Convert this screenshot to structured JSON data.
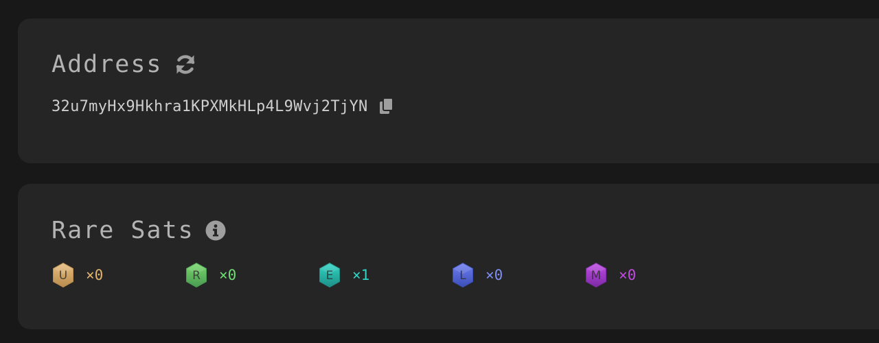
{
  "address": {
    "title": "Address",
    "value": "32u7myHx9Hkhra1KPXMkHLp4L9Wvj2TjYN",
    "refresh_icon": "refresh-icon",
    "copy_icon": "copy-icon"
  },
  "rare_sats": {
    "title": "Rare Sats",
    "info_icon": "info-icon",
    "items": [
      {
        "letter": "U",
        "count": "×0",
        "color": "#e2b36e",
        "badge_top": "#e7bd7e",
        "badge_bottom": "#b98c4e",
        "icon": "uncommon-badge-icon"
      },
      {
        "letter": "R",
        "count": "×0",
        "color": "#6fdc75",
        "badge_top": "#78d86c",
        "badge_bottom": "#4a9a52",
        "icon": "rare-badge-icon"
      },
      {
        "letter": "E",
        "count": "×1",
        "color": "#31d4c4",
        "badge_top": "#2fd6c6",
        "badge_bottom": "#1f8f86",
        "icon": "epic-badge-icon"
      },
      {
        "letter": "L",
        "count": "×0",
        "color": "#7f8df0",
        "badge_top": "#6f7ef0",
        "badge_bottom": "#3c4fb8",
        "icon": "legendary-badge-icon"
      },
      {
        "letter": "M",
        "count": "×0",
        "color": "#c04be0",
        "badge_top": "#c24ce6",
        "badge_bottom": "#7d2aa6",
        "icon": "mythic-badge-icon"
      }
    ]
  }
}
